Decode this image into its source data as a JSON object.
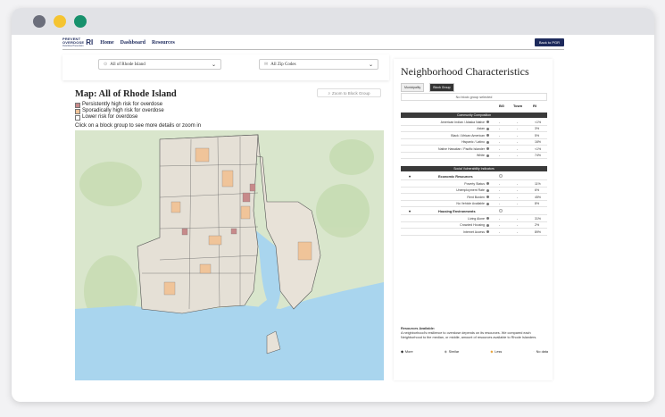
{
  "browser": {
    "dots": [
      "#6b6e7b",
      "#f5c431",
      "#17916c"
    ]
  },
  "nav": {
    "logo_line1": "PREVENT",
    "logo_line2": "OVERDOSE",
    "logo_ri": "RI",
    "logo_sub": "Overdose Prevention",
    "links": [
      "Home",
      "Dashboard",
      "Resources"
    ],
    "back_label": "Back to PGR"
  },
  "selectors": {
    "municipality": "All of Rhode Island",
    "zip": "All Zip Codes"
  },
  "map": {
    "title": "Map: All of Rhode Island",
    "zoom_label": "Zoom to Block Group",
    "legend": [
      {
        "label": "Persistently high risk for overdose",
        "color": "#c78a8a"
      },
      {
        "label": "Sporadically high risk for overdose",
        "color": "#f0c499"
      },
      {
        "label": "Lower risk for overdose",
        "color": "#ffffff"
      }
    ],
    "hint": "Click on a block group to see more details or zoom in"
  },
  "panel": {
    "title": "Neighborhood Characteristics",
    "tabs": [
      "Municipality",
      "Block Group"
    ],
    "no_selection": "No block group selected",
    "columns": [
      "BG",
      "Town",
      "RI"
    ],
    "community_header": "Community Composition",
    "community_rows": [
      {
        "label": "American Indian / Alaska Native",
        "bg": "-",
        "town": "-",
        "ri": "<1%"
      },
      {
        "label": "Asian",
        "bg": "-",
        "town": "-",
        "ri": "3%"
      },
      {
        "label": "Black / African American",
        "bg": "-",
        "town": "-",
        "ri": "5%"
      },
      {
        "label": "Hispanic / Latino",
        "bg": "-",
        "town": "-",
        "ri": "16%"
      },
      {
        "label": "Native Hawaiian / Pacific Islander",
        "bg": "-",
        "town": "-",
        "ri": "<1%"
      },
      {
        "label": "White",
        "bg": "-",
        "town": "-",
        "ri": "74%"
      }
    ],
    "svi_header": "Social Vulnerability Indicators",
    "econ_label": "Economic Resources",
    "econ_rows": [
      {
        "label": "Poverty Status",
        "bg": "-",
        "town": "-",
        "ri": "11%"
      },
      {
        "label": "Unemployment Rate",
        "bg": "-",
        "town": "-",
        "ri": "6%"
      },
      {
        "label": "Rent Burden",
        "bg": "-",
        "town": "-",
        "ri": "45%"
      },
      {
        "label": "No Vehicle Available",
        "bg": "-",
        "town": "-",
        "ri": "8%"
      }
    ],
    "housing_label": "Housing Environments",
    "housing_rows": [
      {
        "label": "Living Alone",
        "bg": "-",
        "town": "-",
        "ri": "31%"
      },
      {
        "label": "Crowded Housing",
        "bg": "-",
        "town": "-",
        "ri": "2%"
      },
      {
        "label": "Internet Access",
        "bg": "-",
        "town": "-",
        "ri": "89%"
      }
    ],
    "footer_title": "Resources Available:",
    "footer_text": "A neighborhood's resilience to overdose depends on its resources. We compared each Neighborhood to the median, or middle, amount of resources available to Rhode Islanders.",
    "keys": [
      "More",
      "Similar",
      "Less",
      "No data"
    ]
  }
}
